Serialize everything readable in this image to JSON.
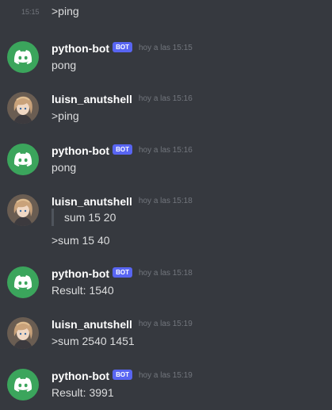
{
  "continuation": {
    "time": "15:15",
    "text": ">ping"
  },
  "messages": [
    {
      "author": "python-bot",
      "bot": true,
      "badge": "BOT",
      "time": "hoy a las 15:15",
      "text": "pong"
    },
    {
      "author": "luisn_anutshell",
      "bot": false,
      "time": "hoy a las 15:16",
      "text": ">ping"
    },
    {
      "author": "python-bot",
      "bot": true,
      "badge": "BOT",
      "time": "hoy a las 15:16",
      "text": "pong"
    },
    {
      "author": "luisn_anutshell",
      "bot": false,
      "time": "hoy a las 15:18",
      "quote": "sum 15 20",
      "text": ">sum 15 40"
    },
    {
      "author": "python-bot",
      "bot": true,
      "badge": "BOT",
      "time": "hoy a las 15:18",
      "text": "Result: 1540"
    },
    {
      "author": "luisn_anutshell",
      "bot": false,
      "time": "hoy a las 15:19",
      "text": ">sum 2540 1451"
    },
    {
      "author": "python-bot",
      "bot": true,
      "badge": "BOT",
      "time": "hoy a las 15:19",
      "text": "Result: 3991"
    }
  ],
  "colors": {
    "background": "#36393f",
    "bot_avatar": "#3ba55c",
    "bot_badge": "#5865f2",
    "username": "#ffffff",
    "timestamp": "#72767d",
    "text": "#dcddde"
  },
  "icons": {
    "bot_avatar": "discord-logo-icon",
    "user_avatar": "anime-avatar"
  }
}
